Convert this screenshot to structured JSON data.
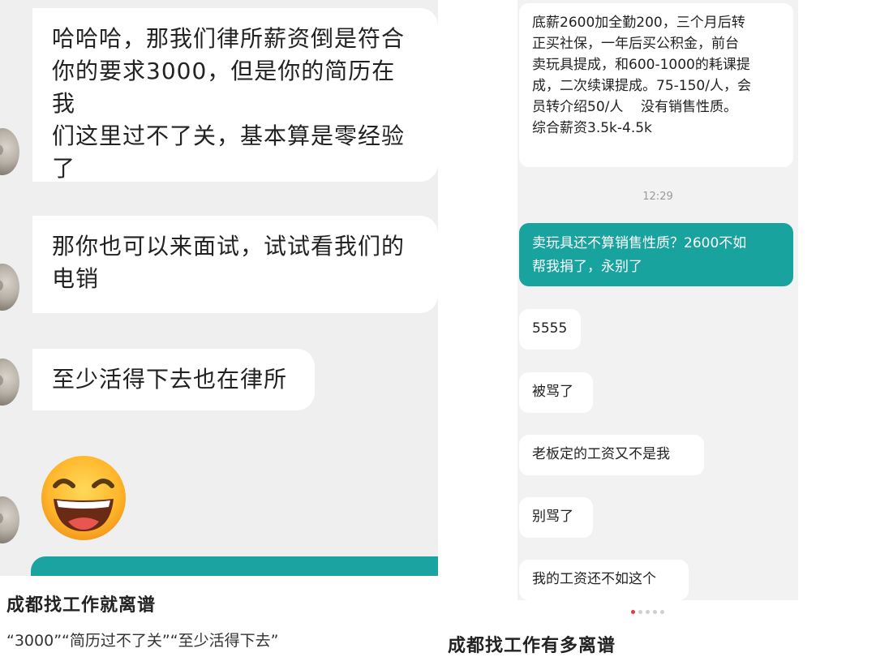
{
  "left": {
    "messages": [
      "哈哈哈，那我们律所薪资倒是符合\n你的要求3000，但是你的简历在我\n们这里过不了关，基本算是零经验\n了",
      "那你也可以来面试，试试看我们的\n电销",
      "至少活得下去也在律所"
    ],
    "emoji": "grinning-face-emoji",
    "caption_title": "成都找工作就离谱",
    "caption_sub": "“3000”“简历过不了关”“至少活得下去”"
  },
  "right": {
    "messages": [
      "底薪2600加全勤200，三个月后转\n正买社保，一年后买公积金，前台\n卖玩具提成，和600-1000的耗课提\n成，二次续课提成。75-150/人，会\n员转介绍50/人    没有销售性质。\n综合薪资3.5k-4.5k",
      "卖玩具还不算销售性质？2600不如\n帮我捐了，永别了",
      "5555",
      "被骂了",
      "老板定的工资又不是我",
      "别骂了",
      "我的工资还不如这个"
    ],
    "time": "12:29",
    "caption_title": "成都找工作有多离谱"
  },
  "colors": {
    "accent": "#18a39f",
    "chat_bg": "#efefef",
    "dot_active": "#e23b3b"
  }
}
